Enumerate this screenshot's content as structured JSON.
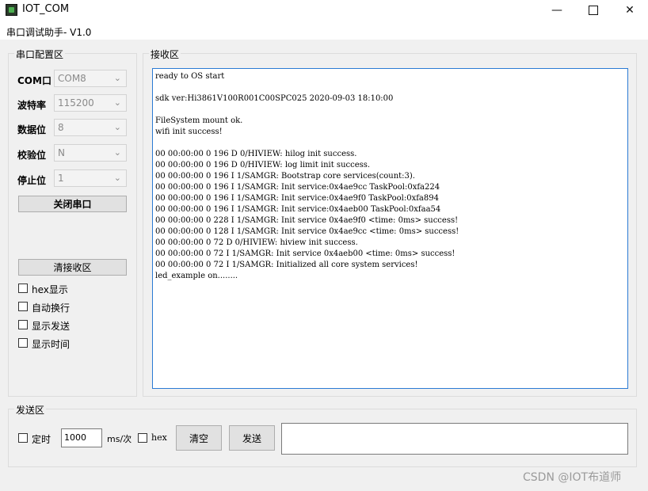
{
  "window": {
    "title": "IOT_COM",
    "subtitle": "串口调试助手- V1.0",
    "minimize_glyph": "—",
    "close_glyph": "✕"
  },
  "serial_config": {
    "group_label": "串口配置区",
    "fields": [
      {
        "label": "COM口",
        "value": "COM8"
      },
      {
        "label": "波特率",
        "value": "115200"
      },
      {
        "label": "数据位",
        "value": "8"
      },
      {
        "label": "校验位",
        "value": "N"
      },
      {
        "label": "停止位",
        "value": "1"
      }
    ],
    "dropdown_glyph": "⌄",
    "close_port_label": "关闭串口",
    "clear_recv_label": "清接收区",
    "checkboxes": [
      {
        "label": "hex显示",
        "checked": false
      },
      {
        "label": "自动换行",
        "checked": false
      },
      {
        "label": "显示发送",
        "checked": false
      },
      {
        "label": "显示时间",
        "checked": false
      }
    ]
  },
  "receive": {
    "group_label": "接收区",
    "text": "ready to OS start\n\nsdk ver:Hi3861V100R001C00SPC025 2020-09-03 18:10:00\n\nFileSystem mount ok.\nwifi init success!\n\n00 00:00:00 0 196 D 0/HIVIEW: hilog init success.\n00 00:00:00 0 196 D 0/HIVIEW: log limit init success.\n00 00:00:00 0 196 I 1/SAMGR: Bootstrap core services(count:3).\n00 00:00:00 0 196 I 1/SAMGR: Init service:0x4ae9cc TaskPool:0xfa224\n00 00:00:00 0 196 I 1/SAMGR: Init service:0x4ae9f0 TaskPool:0xfa894\n00 00:00:00 0 196 I 1/SAMGR: Init service:0x4aeb00 TaskPool:0xfaa54\n00 00:00:00 0 228 I 1/SAMGR: Init service 0x4ae9f0 <time: 0ms> success!\n00 00:00:00 0 128 I 1/SAMGR: Init service 0x4ae9cc <time: 0ms> success!\n00 00:00:00 0 72 D 0/HIVIEW: hiview init success.\n00 00:00:00 0 72 I 1/SAMGR: Init service 0x4aeb00 <time: 0ms> success!\n00 00:00:00 0 72 I 1/SAMGR: Initialized all core system services!\nled_example on........"
  },
  "send": {
    "group_label": "发送区",
    "timer_label": "定时",
    "interval_value": "1000",
    "unit_label": "ms/次",
    "hex_label": "hex",
    "clear_label": "清空",
    "send_label": "发送",
    "input_value": ""
  },
  "watermark": "CSDN @IOT布道师"
}
